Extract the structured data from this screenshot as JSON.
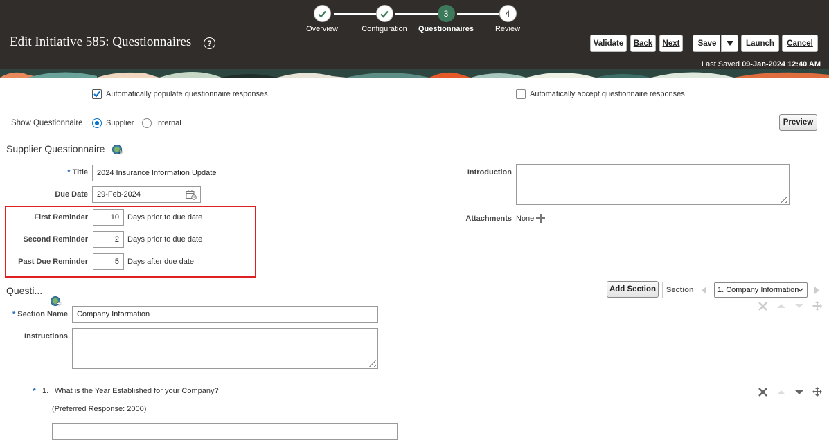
{
  "train": {
    "stops": [
      {
        "label": "Overview",
        "state": "done"
      },
      {
        "label": "Configuration",
        "state": "done"
      },
      {
        "label": "Questionnaires",
        "number": "3",
        "state": "active"
      },
      {
        "label": "Review",
        "number": "4",
        "state": "pending"
      }
    ]
  },
  "header": {
    "title": "Edit Initiative 585: Questionnaires",
    "help": "?",
    "buttons": {
      "validate": "Validate",
      "back": "Back",
      "next": "Next",
      "save": "Save",
      "launch": "Launch",
      "cancel": "Cancel"
    },
    "last_saved_label": "Last Saved",
    "last_saved_value": "09-Jan-2024 12:40 AM"
  },
  "options": {
    "auto_populate_label": "Automatically populate questionnaire responses",
    "auto_populate_checked": true,
    "auto_accept_label": "Automatically accept questionnaire responses",
    "auto_accept_checked": false,
    "show_questionnaire_label": "Show Questionnaire",
    "radio_supplier": "Supplier",
    "radio_internal": "Internal",
    "selected": "Supplier",
    "preview_button": "Preview"
  },
  "supplier_questionnaire": {
    "section_title": "Supplier Questionnaire",
    "title_label": "Title",
    "title_value": "2024 Insurance Information Update",
    "due_date_label": "Due Date",
    "due_date_value": "29-Feb-2024",
    "introduction_label": "Introduction",
    "introduction_value": "",
    "attachments_label": "Attachments",
    "attachments_value": "None",
    "reminders": [
      {
        "label": "First Reminder",
        "value": "10",
        "suffix": "Days prior to due date"
      },
      {
        "label": "Second Reminder",
        "value": "2",
        "suffix": "Days prior to due date"
      },
      {
        "label": "Past Due Reminder",
        "value": "5",
        "suffix": "Days after due date"
      }
    ]
  },
  "questions_section": {
    "title": "Questi...",
    "add_section_button": "Add Section",
    "section_label": "Section",
    "section_selected": "1. Company Information",
    "section_name_label": "Section Name",
    "section_name_value": "Company Information",
    "instructions_label": "Instructions",
    "instructions_value": "",
    "questions": [
      {
        "number": "1.",
        "text": "What is the Year Established for your Company?",
        "preferred_response": "(Preferred Response: 2000)",
        "answer": ""
      }
    ]
  },
  "colors": {
    "header_bg": "#312d2a",
    "active_step": "#3d7a5c",
    "highlight_border": "#e02020",
    "radio_accent": "#0572ce"
  }
}
